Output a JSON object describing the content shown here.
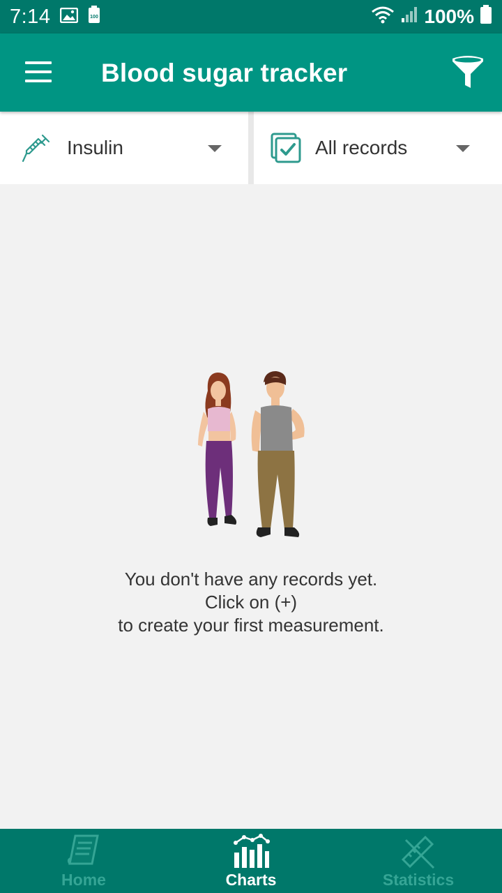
{
  "status_bar": {
    "time": "7:14",
    "battery_percent": "100%",
    "icons": [
      "image-icon",
      "battery-saver-icon",
      "wifi-icon",
      "signal-icon",
      "battery-icon"
    ]
  },
  "app_bar": {
    "title": "Blood sugar tracker",
    "menu_icon": "hamburger-menu-icon",
    "filter_icon": "filter-icon"
  },
  "selectors": {
    "type": {
      "label": "Insulin",
      "icon": "syringe-icon"
    },
    "records": {
      "label": "All records",
      "icon": "checkbox-icon"
    }
  },
  "empty_state": {
    "line1": "You don't have any records yet.",
    "line2": "Click on (+)",
    "line3": "to create your first measurement."
  },
  "bottom_nav": {
    "items": [
      {
        "label": "Home",
        "icon": "notes-icon",
        "active": false
      },
      {
        "label": "Charts",
        "icon": "bar-chart-icon",
        "active": true
      },
      {
        "label": "Statistics",
        "icon": "ruler-pencil-icon",
        "active": false
      }
    ]
  },
  "colors": {
    "status_bar": "#00786a",
    "app_bar": "#009583",
    "accent": "#2e9a8e",
    "background": "#f2f2f2",
    "nav_inactive": "#35a595",
    "nav_active": "#ffffff"
  }
}
